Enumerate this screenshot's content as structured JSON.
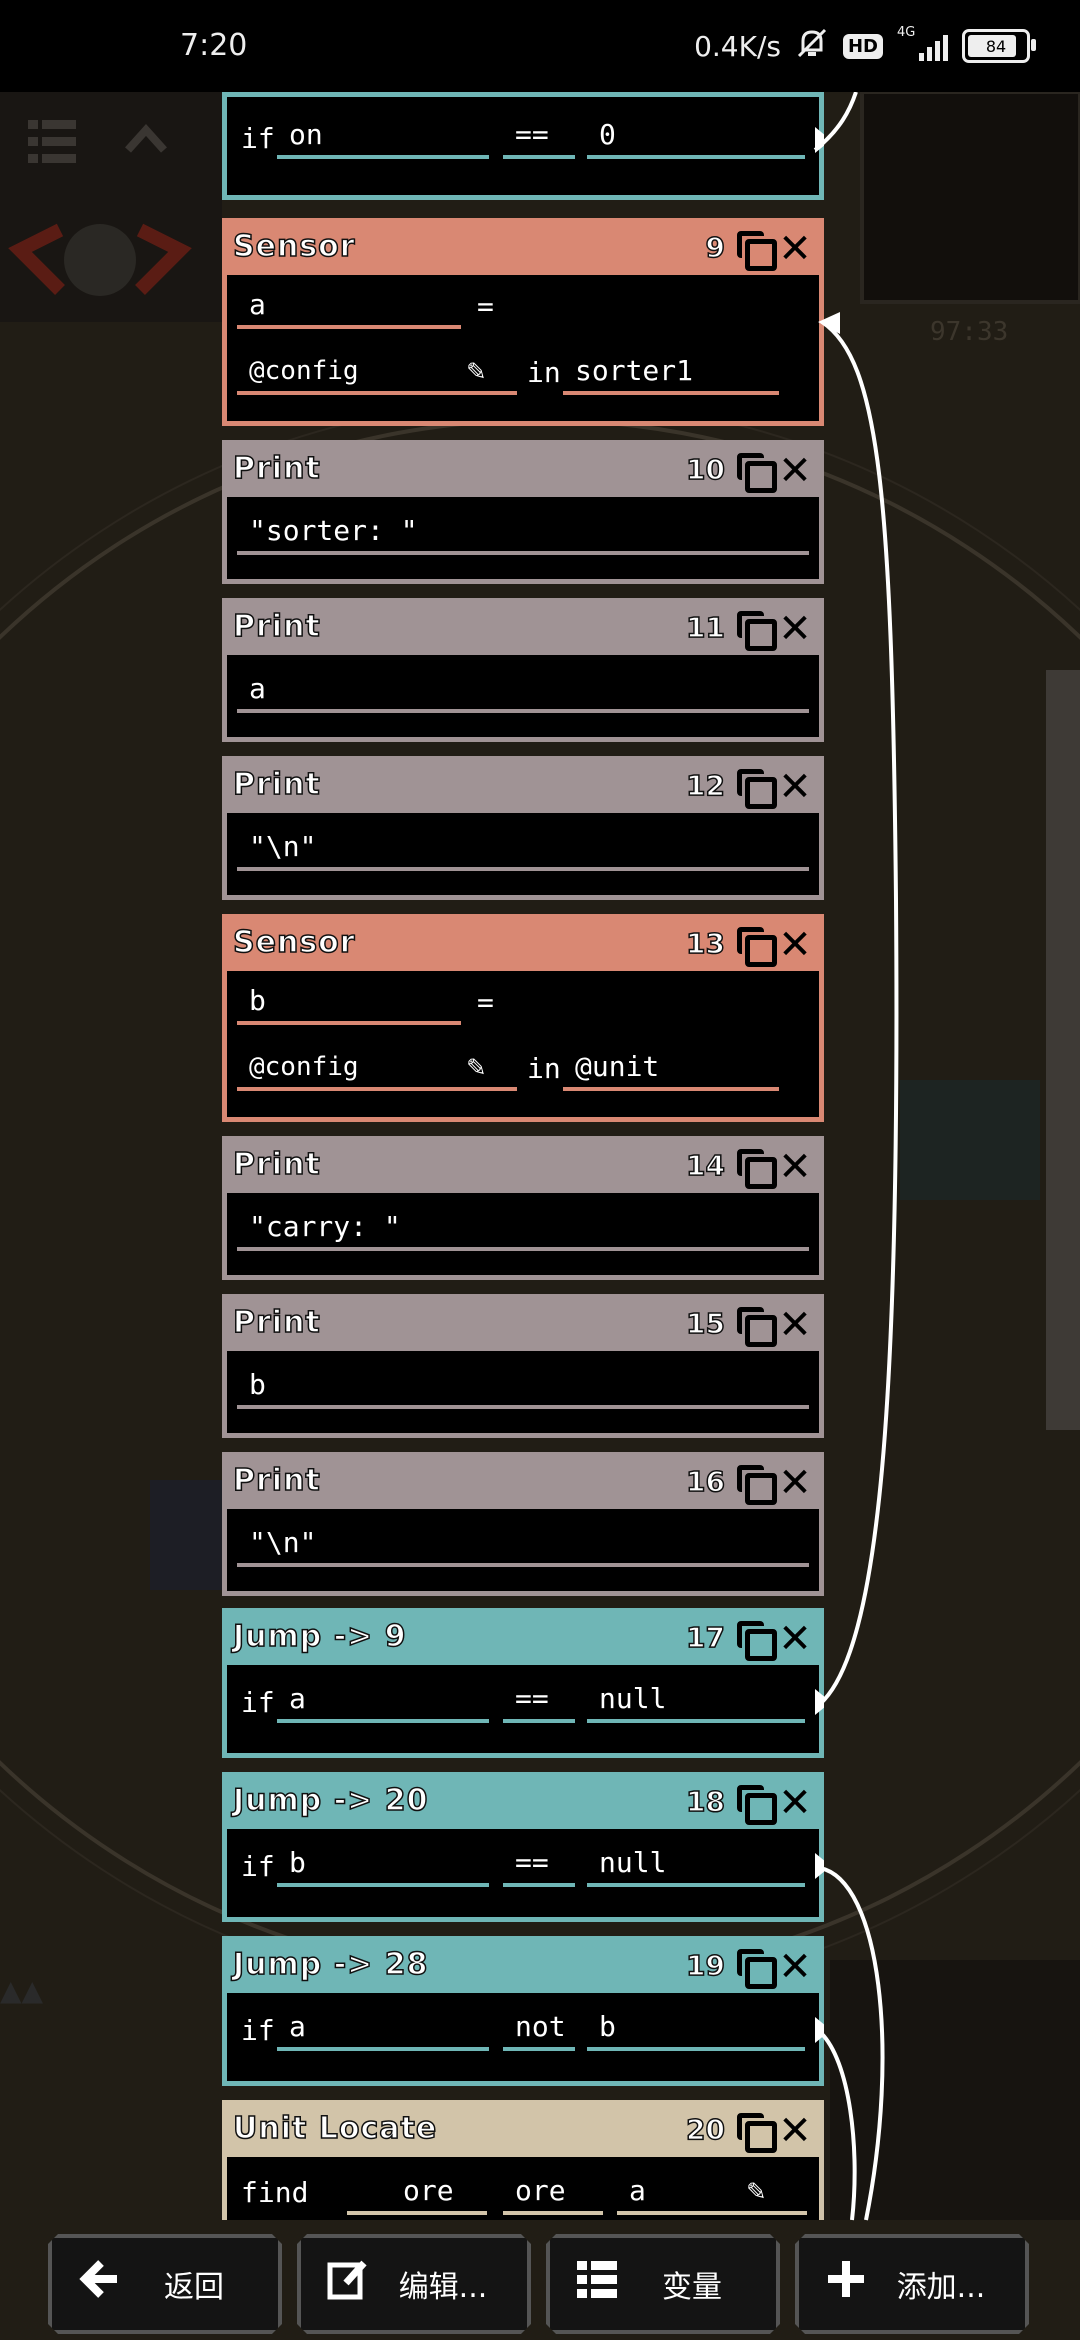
{
  "status_bar": {
    "time": "7:20",
    "net_speed": "0.4K/s",
    "hd": "HD",
    "signal": "4G",
    "battery": "84"
  },
  "instructions": [
    {
      "type": "jump",
      "title": "",
      "num": "",
      "row": {
        "if": "if",
        "a": "on",
        "op": "==",
        "b": "0"
      }
    },
    {
      "type": "sensor",
      "title": "Sensor",
      "num": "9",
      "row1": {
        "var": "a",
        "eq": "="
      },
      "row2": {
        "sensor": "@config",
        "in": "in",
        "target": "sorter1"
      }
    },
    {
      "type": "print",
      "title": "Print",
      "num": "10",
      "text": "\"sorter: \""
    },
    {
      "type": "print",
      "title": "Print",
      "num": "11",
      "text": "a"
    },
    {
      "type": "print",
      "title": "Print",
      "num": "12",
      "text": "\"\\n\""
    },
    {
      "type": "sensor",
      "title": "Sensor",
      "num": "13",
      "row1": {
        "var": "b",
        "eq": "="
      },
      "row2": {
        "sensor": "@config",
        "in": "in",
        "target": "@unit"
      }
    },
    {
      "type": "print",
      "title": "Print",
      "num": "14",
      "text": "\"carry: \""
    },
    {
      "type": "print",
      "title": "Print",
      "num": "15",
      "text": "b"
    },
    {
      "type": "print",
      "title": "Print",
      "num": "16",
      "text": "\"\\n\""
    },
    {
      "type": "jump",
      "title": "Jump -> 9",
      "num": "17",
      "row": {
        "if": "if",
        "a": "a",
        "op": "==",
        "b": "null"
      }
    },
    {
      "type": "jump",
      "title": "Jump -> 20",
      "num": "18",
      "row": {
        "if": "if",
        "a": "b",
        "op": "==",
        "b": "null"
      }
    },
    {
      "type": "jump",
      "title": "Jump -> 28",
      "num": "19",
      "row": {
        "if": "if",
        "a": "a",
        "op": "not",
        "b": "b"
      }
    },
    {
      "type": "unit",
      "title": "Unit Locate",
      "num": "20",
      "row": {
        "find": "find",
        "a": "ore",
        "b": "ore",
        "c": "a"
      }
    }
  ],
  "toolbar": {
    "back_label": "返回",
    "edit_label": "编辑...",
    "vars_label": "变量",
    "add_label": "添加..."
  },
  "colors": {
    "jump": "#6fb6b6",
    "sensor": "#d98873",
    "print": "#a09395",
    "unit_locate": "#d2c4a9"
  }
}
